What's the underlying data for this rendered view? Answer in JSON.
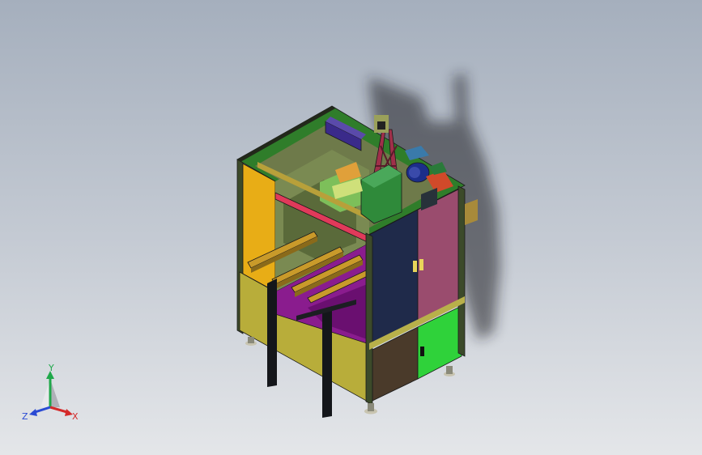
{
  "viewport": {
    "background_top": "#a5afbd",
    "background_bottom": "#e4e6e9"
  },
  "model": {
    "colors": {
      "frame": "#3c4a2a",
      "top_panel": "#2f7d2a",
      "left_panel": "#e8ad16",
      "base_left": "#b8ad3a",
      "front_door_left": "#1f2a4a",
      "front_door_right": "#9a4c6e",
      "lower_door_left": "#4a3a2a",
      "lower_door_right": "#2fd23a",
      "conveyor": "#c99a2a",
      "inner_floor": "#8a1c8e",
      "rail": "#e03a5a",
      "gantry": "#a0304a",
      "motor_green": "#2f8a3a",
      "motor_blue": "#1c2e8a",
      "motor_purple": "#3a2a8a",
      "shadow": "#1a1c20"
    }
  },
  "triad": {
    "y_label": "Y",
    "x_label": "X",
    "z_label": "Z",
    "y_color": "#1fa84a",
    "x_color": "#d42a2a",
    "z_color": "#2a4ad4"
  }
}
